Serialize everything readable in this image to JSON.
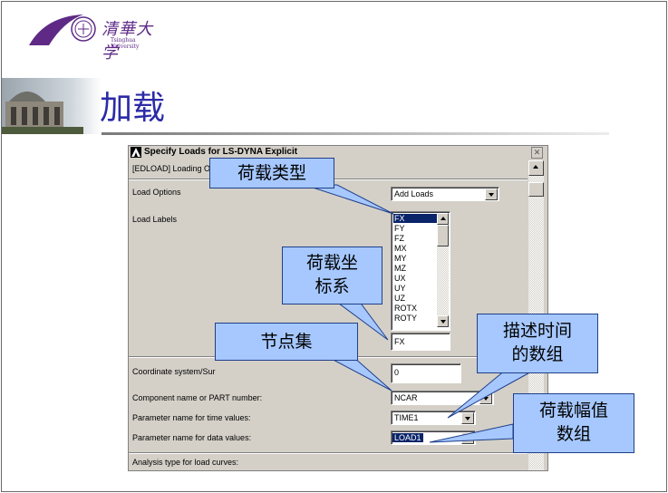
{
  "slide": {
    "logo_text": "清華大学",
    "logo_subtext": "Tsinghua University",
    "title": "加载"
  },
  "dialog": {
    "title": "Specify Loads for LS-DYNA Explicit",
    "header": "[EDLOAD]  Loading O",
    "rows": {
      "load_options_label": "Load Options",
      "load_options_value": "Add Loads",
      "load_labels_label": "Load Labels",
      "label_field_value": "FX",
      "coord_label": "Coordinate system/Sur",
      "coord_value": "0",
      "component_label": "Component name or PART number:",
      "component_value": "NCAR",
      "time_label": "Parameter name for time values:",
      "time_value": "TIME1",
      "data_label": "Parameter name for data values:",
      "data_value": "LOAD1",
      "analysis_label": "Analysis type for load curves:"
    },
    "load_labels": [
      "FX",
      "FY",
      "FZ",
      "MX",
      "MY",
      "MZ",
      "UX",
      "UY",
      "UZ",
      "ROTX",
      "ROTY"
    ],
    "selected_load_label": "FX"
  },
  "callouts": {
    "load_type": "荷载类型",
    "load_coord_line1": "荷载坐",
    "load_coord_line2": "标系",
    "node_set": "节点集",
    "time_array_line1": "描述时间",
    "time_array_line2": "的数组",
    "amplitude_line1": "荷载幅值",
    "amplitude_line2": "数组"
  },
  "colors": {
    "title_blue": "#2b2ba8",
    "callout_fill": "#a6c8ff",
    "selection": "#0a246a",
    "dialog_bg": "#d4d0c8"
  }
}
